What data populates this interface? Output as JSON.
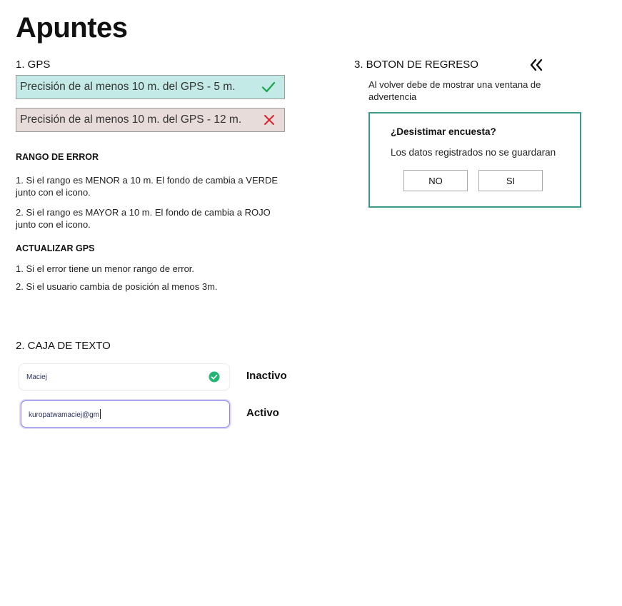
{
  "page": {
    "title": "Apuntes"
  },
  "gps": {
    "section_title": "1. GPS",
    "ok_text": "Precisión de al menos 10 m. del GPS - 5 m.",
    "bad_text": "Precisión de al menos 10 m. del GPS - 12 m.",
    "ok_icon": "check-icon",
    "bad_icon": "cross-icon",
    "ok_bg": "#c3eae6",
    "bad_bg": "#e8dcda",
    "ok_icon_color": "#16a34a",
    "bad_icon_color": "#e11d27",
    "range_heading": "RANGO DE ERROR",
    "range_item1": "1. Si el rango es MENOR a 10 m. El fondo de cambia a VERDE junto con el icono.",
    "range_item2": "2. Si el rango es MAYOR a 10 m. El fondo de cambia a ROJO junto con el icono.",
    "update_heading": "ACTUALIZAR GPS",
    "update_item1": "1. Si el error tiene un menor rango de error.",
    "update_item2": "2. Si el usuario cambia de posición al menos 3m."
  },
  "textbox": {
    "section_title": "2. CAJA DE TEXTO",
    "inactive_value": "Maciej",
    "inactive_label": "Inactivo",
    "active_value": "kuropatwamaciej@gm",
    "active_label": "Activo",
    "valid_icon": "check-circle-icon",
    "focus_color": "#8e86e8"
  },
  "back": {
    "section_title": "3. BOTON DE REGRESO",
    "icon": "double-chevron-left-icon",
    "description": "Al volver debe de mostrar una ventana de advertencia",
    "dialog_title": "¿Desistimar encuesta?",
    "dialog_message": "Los datos registrados no se guardaran",
    "no_label": "NO",
    "yes_label": "SI",
    "border_color": "#3a9a8c"
  }
}
